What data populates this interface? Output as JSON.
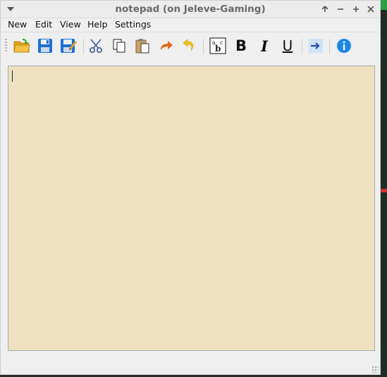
{
  "window": {
    "title": "notepad (on Jeleve-Gaming)"
  },
  "menubar": {
    "items": [
      {
        "label": "New"
      },
      {
        "label": "Edit"
      },
      {
        "label": "View"
      },
      {
        "label": "Help"
      },
      {
        "label": "Settings"
      }
    ]
  },
  "toolbar": {
    "icons": [
      "open-folder-icon",
      "save-icon",
      "save-as-icon",
      "cut-icon",
      "copy-icon",
      "paste-icon",
      "redo-icon",
      "undo-icon",
      "font-icon",
      "bold-icon",
      "italic-icon",
      "underline-icon",
      "go-icon",
      "info-icon"
    ],
    "bold_label": "B",
    "italic_label": "I",
    "underline_label": "U"
  },
  "editor": {
    "text": ""
  },
  "colors": {
    "editor_bg": "#efe1c0",
    "window_bg": "#efefef",
    "info_blue": "#1e88e5",
    "folder_green": "#3aa635",
    "save_blue": "#1f6fd0",
    "redo_orange": "#e06a1b",
    "undo_yellow": "#f0c419"
  }
}
